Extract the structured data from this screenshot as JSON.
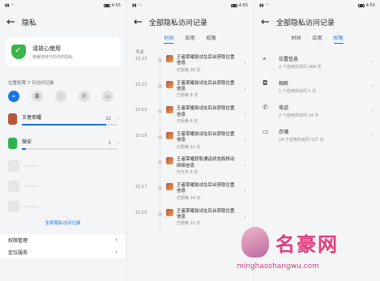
{
  "status_time": "4:55",
  "panel1": {
    "title": "隐私",
    "card_title": "请放心使用",
    "card_sub": "荣耀将持守护你的隐私",
    "section": "位置权限 7 日访问记录",
    "perm_icons": [
      "location-icon",
      "camera-icon",
      "microphone-icon",
      "phone-icon",
      "folder-icon"
    ],
    "apps": [
      {
        "name": "王者荣耀",
        "count": "22",
        "level": 0.88,
        "color": "#b8553a"
      },
      {
        "name": "微安",
        "count": "1",
        "level": 0.04,
        "color": "#2bb24c"
      }
    ],
    "link": "全部隐私访问记录",
    "menu": [
      "权限管理",
      "定位服务"
    ]
  },
  "panel2": {
    "title": "全部隐私访问记录",
    "tabs": [
      "时间",
      "应用",
      "权限"
    ],
    "active_tab": 0,
    "day": "今天",
    "events": [
      {
        "time": "15:23",
        "text": "王者荣耀尝试在后台获取位置信息",
        "sub": "已拒绝 28 次"
      },
      {
        "time": "15:22",
        "text": "王者荣耀尝试在后台获取位置信息",
        "sub": "已拒绝 8 次"
      },
      {
        "time": "15:19",
        "text": "王者荣耀尝试在后台获取位置信息",
        "sub": "已拒绝 8 次"
      },
      {
        "time": "15:18",
        "text": "王者荣耀尝试在后台获取位置信息",
        "sub": "已拒绝 12 次"
      },
      {
        "time": "",
        "text": "王者荣耀获取通话状态和移动网络信息",
        "sub": "已允许 6 次"
      },
      {
        "time": "15:17",
        "text": "王者荣耀尝试在后台获取位置信息",
        "sub": "已拒绝 14 次"
      },
      {
        "time": "15:16",
        "text": "王者荣耀尝试在后台获取位置信息",
        "sub": "已拒绝 12 次"
      }
    ]
  },
  "panel3": {
    "title": "全部隐私访问记录",
    "tabs": [
      "时间",
      "应用",
      "权限"
    ],
    "active_tab": 2,
    "cats": [
      {
        "icon": "location-icon",
        "glyph": "⌖",
        "name": "位置信息",
        "sub": "2 个应用共访问 264 次"
      },
      {
        "icon": "camera-icon",
        "glyph": "◘",
        "name": "相机",
        "sub": "1 个应用共访问 1 次"
      },
      {
        "icon": "phone-icon",
        "glyph": "✆",
        "name": "电话",
        "sub": "2 个应用共访问 14 次"
      },
      {
        "icon": "folder-icon",
        "glyph": "▭",
        "name": "存储",
        "sub": "14 个应用共访问 127 次"
      }
    ]
  },
  "watermark": {
    "text": "名豪网",
    "url": "minghaoshangwu.com"
  }
}
